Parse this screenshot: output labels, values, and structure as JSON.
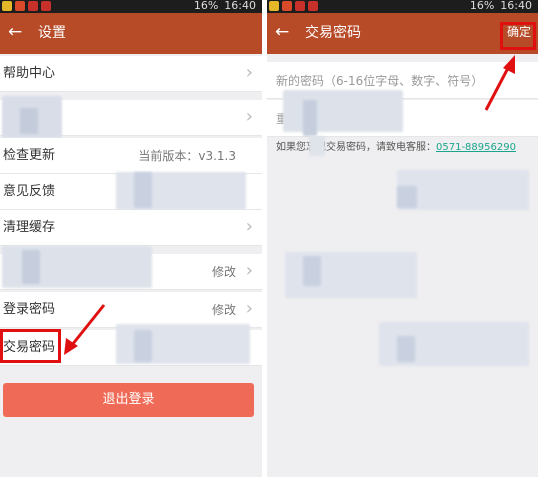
{
  "left": {
    "status": {
      "time": "16:40",
      "battery": "16%"
    },
    "header": {
      "back_icon": "arrow-left-icon",
      "title": "设置"
    },
    "rows": [
      {
        "label": "帮助中心",
        "value": ""
      },
      {
        "label": "",
        "value": ""
      },
      {
        "label": "检查更新",
        "value": "当前版本：v3.1.3"
      },
      {
        "label": "意见反馈",
        "value": ""
      },
      {
        "label": "清理缓存",
        "value": ""
      },
      {
        "label": "",
        "value": "修改"
      },
      {
        "label": "登录密码",
        "value": "修改"
      },
      {
        "label": "交易密码",
        "value": ""
      }
    ],
    "logout_label": "退出登录"
  },
  "right": {
    "status": {
      "time": "16:40",
      "battery": "16%"
    },
    "header": {
      "back_icon": "arrow-left-icon",
      "title": "交易密码",
      "confirm_label": "确定"
    },
    "new_password_placeholder": "新的密码（6-16位字母、数字、符号）",
    "repeat_password_placeholder": "重",
    "hint_text": "如果您忘记交易密码，请致电客服：",
    "hint_phone": "0571-88956290"
  },
  "colors": {
    "header": "#b74a27",
    "logout": "#ef6b57",
    "callout": "#e01010",
    "link": "#1ba48c"
  }
}
